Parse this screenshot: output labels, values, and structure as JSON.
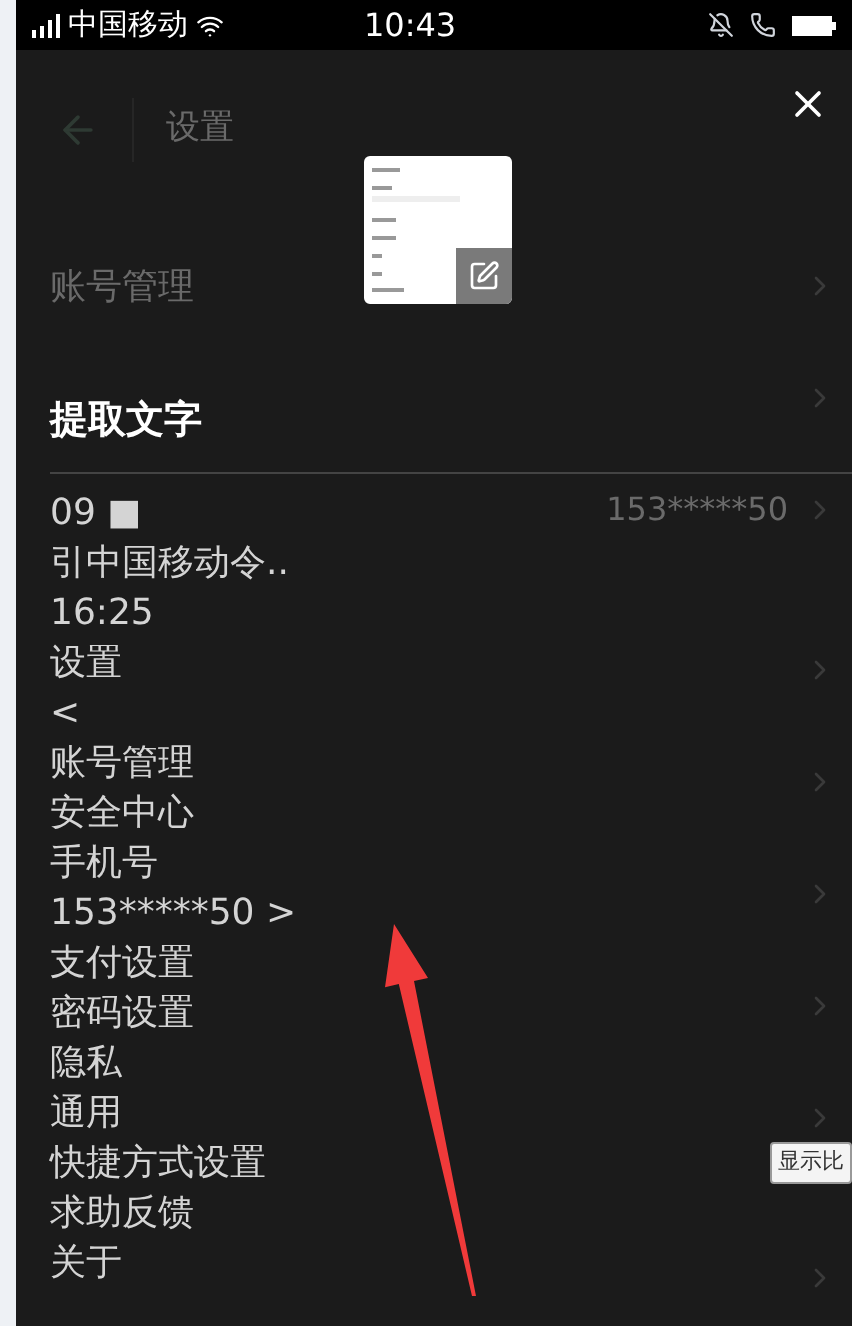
{
  "status_bar": {
    "carrier": "中国移动",
    "time": "10:43"
  },
  "background": {
    "title": "设置",
    "sections": [
      [
        {
          "kind": "label",
          "label": "账号管理"
        },
        {
          "kind": "plain"
        },
        {
          "kind": "value",
          "value": "153*****50"
        }
      ],
      [
        {
          "kind": "plain"
        },
        {
          "kind": "plain"
        },
        {
          "kind": "plain"
        },
        {
          "kind": "plain"
        },
        {
          "kind": "plain"
        }
      ],
      [
        {
          "kind": "plain"
        }
      ]
    ]
  },
  "extract_panel": {
    "title": "提取文字",
    "lines": [
      "09 ■",
      "引中国移动令..",
      "16:25",
      "设置",
      "<",
      "账号管理",
      "安全中心",
      "手机号",
      "153*****50 >",
      "支付设置",
      "密码设置",
      "隐私",
      "通用",
      "快捷方式设置",
      "求助反馈",
      "关于"
    ]
  },
  "tooltip": {
    "text": "显示比"
  }
}
